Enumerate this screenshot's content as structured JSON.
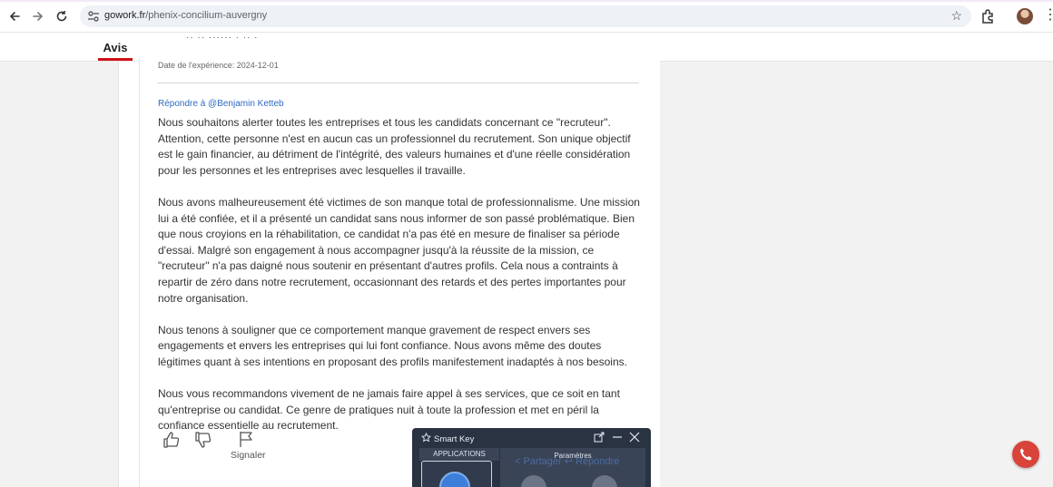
{
  "browser": {
    "url_domain": "gowork.fr",
    "url_path": "/phenix-concilium-auvergny"
  },
  "tabs": {
    "active": "Avis"
  },
  "review": {
    "experience_date": "Date de l'expérience: 2024-12-01",
    "reply_to": "Répondre à @Benjamin Ketteb",
    "paragraphs": [
      "Nous souhaitons alerter toutes les entreprises et tous les candidats concernant ce \"recruteur\". Attention, cette personne n'est en aucun cas un professionnel du recrutement. Son unique objectif est le gain financier, au détriment de l'intégrité, des valeurs humaines et d'une réelle considération pour les personnes et les entreprises avec lesquelles il travaille.",
      "Nous avons malheureusement été victimes de son manque total de professionnalisme. Une mission lui a été confiée, et il a présenté un candidat sans nous informer de son passé problématique. Bien que nous croyions en la réhabilitation, ce candidat n'a pas été en mesure de finaliser sa période d'essai. Malgré son engagement à nous accompagner jusqu'à la réussite de la mission, ce \"recruteur\" n'a pas daigné nous soutenir en présentant d'autres profils. Cela nous a contraints à repartir de zéro dans notre recrutement, occasionnant des retards et des pertes importantes pour notre organisation.",
      "Nous tenons à souligner que ce comportement manque gravement de respect envers ses engagements et envers les entreprises qui lui font confiance. Nous avons même des doutes légitimes quant à ses intentions en proposant des profils manifestement inadaptés à nos besoins.",
      "Nous vous recommandons vivement de ne jamais faire appel à ses services, que ce soit en tant qu'entreprise ou candidat. Ce genre de pratiques nuit à toute la profession et met en péril la confiance essentielle au recrutement."
    ],
    "actions": {
      "report": "Signaler",
      "share": "Partager",
      "reply": "Répondre"
    }
  },
  "smart_key": {
    "title": "Smart Key",
    "applications": "APPLICATIONS",
    "parameters": "Paramètres"
  },
  "colors": {
    "accent_red": "#d0101a",
    "link_blue": "#2f6ac4",
    "phone_red": "#d8443a",
    "overlay_bg": "#2a3342"
  }
}
